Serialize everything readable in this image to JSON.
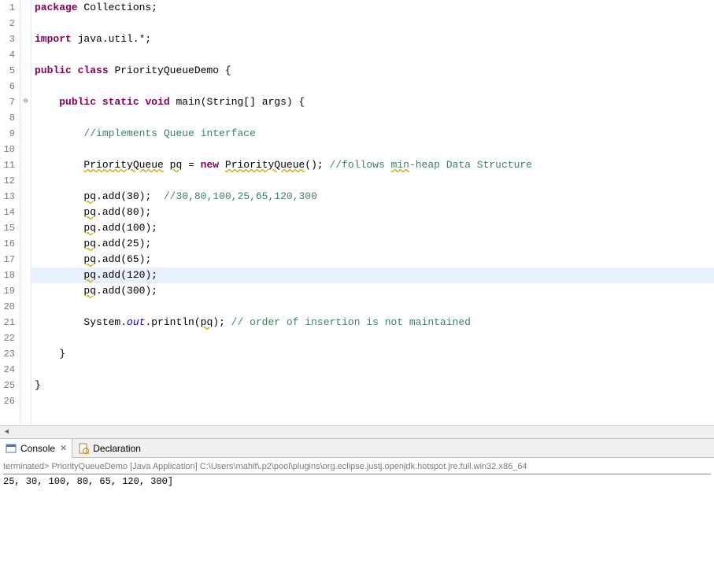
{
  "editor": {
    "highlighted_line": 18,
    "override_marker_line": 7,
    "lines": [
      {
        "n": 1,
        "tokens": [
          {
            "t": "package",
            "c": "kw"
          },
          {
            "t": " Collections;",
            "c": ""
          }
        ]
      },
      {
        "n": 2,
        "tokens": []
      },
      {
        "n": 3,
        "tokens": [
          {
            "t": "import",
            "c": "kw"
          },
          {
            "t": " java.util.*;",
            "c": ""
          }
        ]
      },
      {
        "n": 4,
        "tokens": []
      },
      {
        "n": 5,
        "tokens": [
          {
            "t": "public",
            "c": "kw"
          },
          {
            "t": " ",
            "c": ""
          },
          {
            "t": "class",
            "c": "kw"
          },
          {
            "t": " PriorityQueueDemo {",
            "c": ""
          }
        ]
      },
      {
        "n": 6,
        "tokens": []
      },
      {
        "n": 7,
        "tokens": [
          {
            "t": "    ",
            "c": ""
          },
          {
            "t": "public",
            "c": "kw"
          },
          {
            "t": " ",
            "c": ""
          },
          {
            "t": "static",
            "c": "kw"
          },
          {
            "t": " ",
            "c": ""
          },
          {
            "t": "void",
            "c": "kw"
          },
          {
            "t": " main(String[] args) {",
            "c": ""
          }
        ]
      },
      {
        "n": 8,
        "tokens": []
      },
      {
        "n": 9,
        "tokens": [
          {
            "t": "        ",
            "c": ""
          },
          {
            "t": "//implements Queue interface",
            "c": "cm"
          }
        ]
      },
      {
        "n": 10,
        "tokens": []
      },
      {
        "n": 11,
        "tokens": [
          {
            "t": "        ",
            "c": ""
          },
          {
            "t": "PriorityQueue",
            "c": "warn"
          },
          {
            "t": " ",
            "c": ""
          },
          {
            "t": "pq",
            "c": "warn"
          },
          {
            "t": " = ",
            "c": ""
          },
          {
            "t": "new",
            "c": "kw"
          },
          {
            "t": " ",
            "c": ""
          },
          {
            "t": "PriorityQueue",
            "c": "warn"
          },
          {
            "t": "(); ",
            "c": ""
          },
          {
            "t": "//follows ",
            "c": "cm"
          },
          {
            "t": "min",
            "c": "cm warn"
          },
          {
            "t": "-heap Data Structure",
            "c": "cm"
          }
        ]
      },
      {
        "n": 12,
        "tokens": []
      },
      {
        "n": 13,
        "tokens": [
          {
            "t": "        ",
            "c": ""
          },
          {
            "t": "pq",
            "c": "warn"
          },
          {
            "t": ".add(30);  ",
            "c": ""
          },
          {
            "t": "//30,80,100,25,65,120,300",
            "c": "cm"
          }
        ]
      },
      {
        "n": 14,
        "tokens": [
          {
            "t": "        ",
            "c": ""
          },
          {
            "t": "pq",
            "c": "warn"
          },
          {
            "t": ".add(80);",
            "c": ""
          }
        ]
      },
      {
        "n": 15,
        "tokens": [
          {
            "t": "        ",
            "c": ""
          },
          {
            "t": "pq",
            "c": "warn"
          },
          {
            "t": ".add(100);",
            "c": ""
          }
        ]
      },
      {
        "n": 16,
        "tokens": [
          {
            "t": "        ",
            "c": ""
          },
          {
            "t": "pq",
            "c": "warn"
          },
          {
            "t": ".add(25);",
            "c": ""
          }
        ]
      },
      {
        "n": 17,
        "tokens": [
          {
            "t": "        ",
            "c": ""
          },
          {
            "t": "pq",
            "c": "warn"
          },
          {
            "t": ".add(65);",
            "c": ""
          }
        ]
      },
      {
        "n": 18,
        "tokens": [
          {
            "t": "        ",
            "c": ""
          },
          {
            "t": "pq",
            "c": "warn"
          },
          {
            "t": ".add(120);",
            "c": ""
          }
        ]
      },
      {
        "n": 19,
        "tokens": [
          {
            "t": "        ",
            "c": ""
          },
          {
            "t": "pq",
            "c": "warn"
          },
          {
            "t": ".add(300);",
            "c": ""
          }
        ]
      },
      {
        "n": 20,
        "tokens": []
      },
      {
        "n": 21,
        "tokens": [
          {
            "t": "        System.",
            "c": ""
          },
          {
            "t": "out",
            "c": "field"
          },
          {
            "t": ".println(",
            "c": ""
          },
          {
            "t": "pq",
            "c": "warn"
          },
          {
            "t": "); ",
            "c": ""
          },
          {
            "t": "// order of insertion is not maintained",
            "c": "cm"
          }
        ]
      },
      {
        "n": 22,
        "tokens": []
      },
      {
        "n": 23,
        "tokens": [
          {
            "t": "    }",
            "c": ""
          }
        ]
      },
      {
        "n": 24,
        "tokens": []
      },
      {
        "n": 25,
        "tokens": [
          {
            "t": "}",
            "c": ""
          }
        ]
      },
      {
        "n": 26,
        "tokens": []
      }
    ]
  },
  "bottom": {
    "tabs": {
      "console": "Console",
      "declaration": "Declaration"
    },
    "terminated_line": "terminated> PriorityQueueDemo [Java Application] C:\\Users\\mahit\\.p2\\pool\\plugins\\org.eclipse.justj.openjdk.hotspot.jre.full.win32.x86_64",
    "output": "25, 30, 100, 80, 65, 120, 300]"
  }
}
